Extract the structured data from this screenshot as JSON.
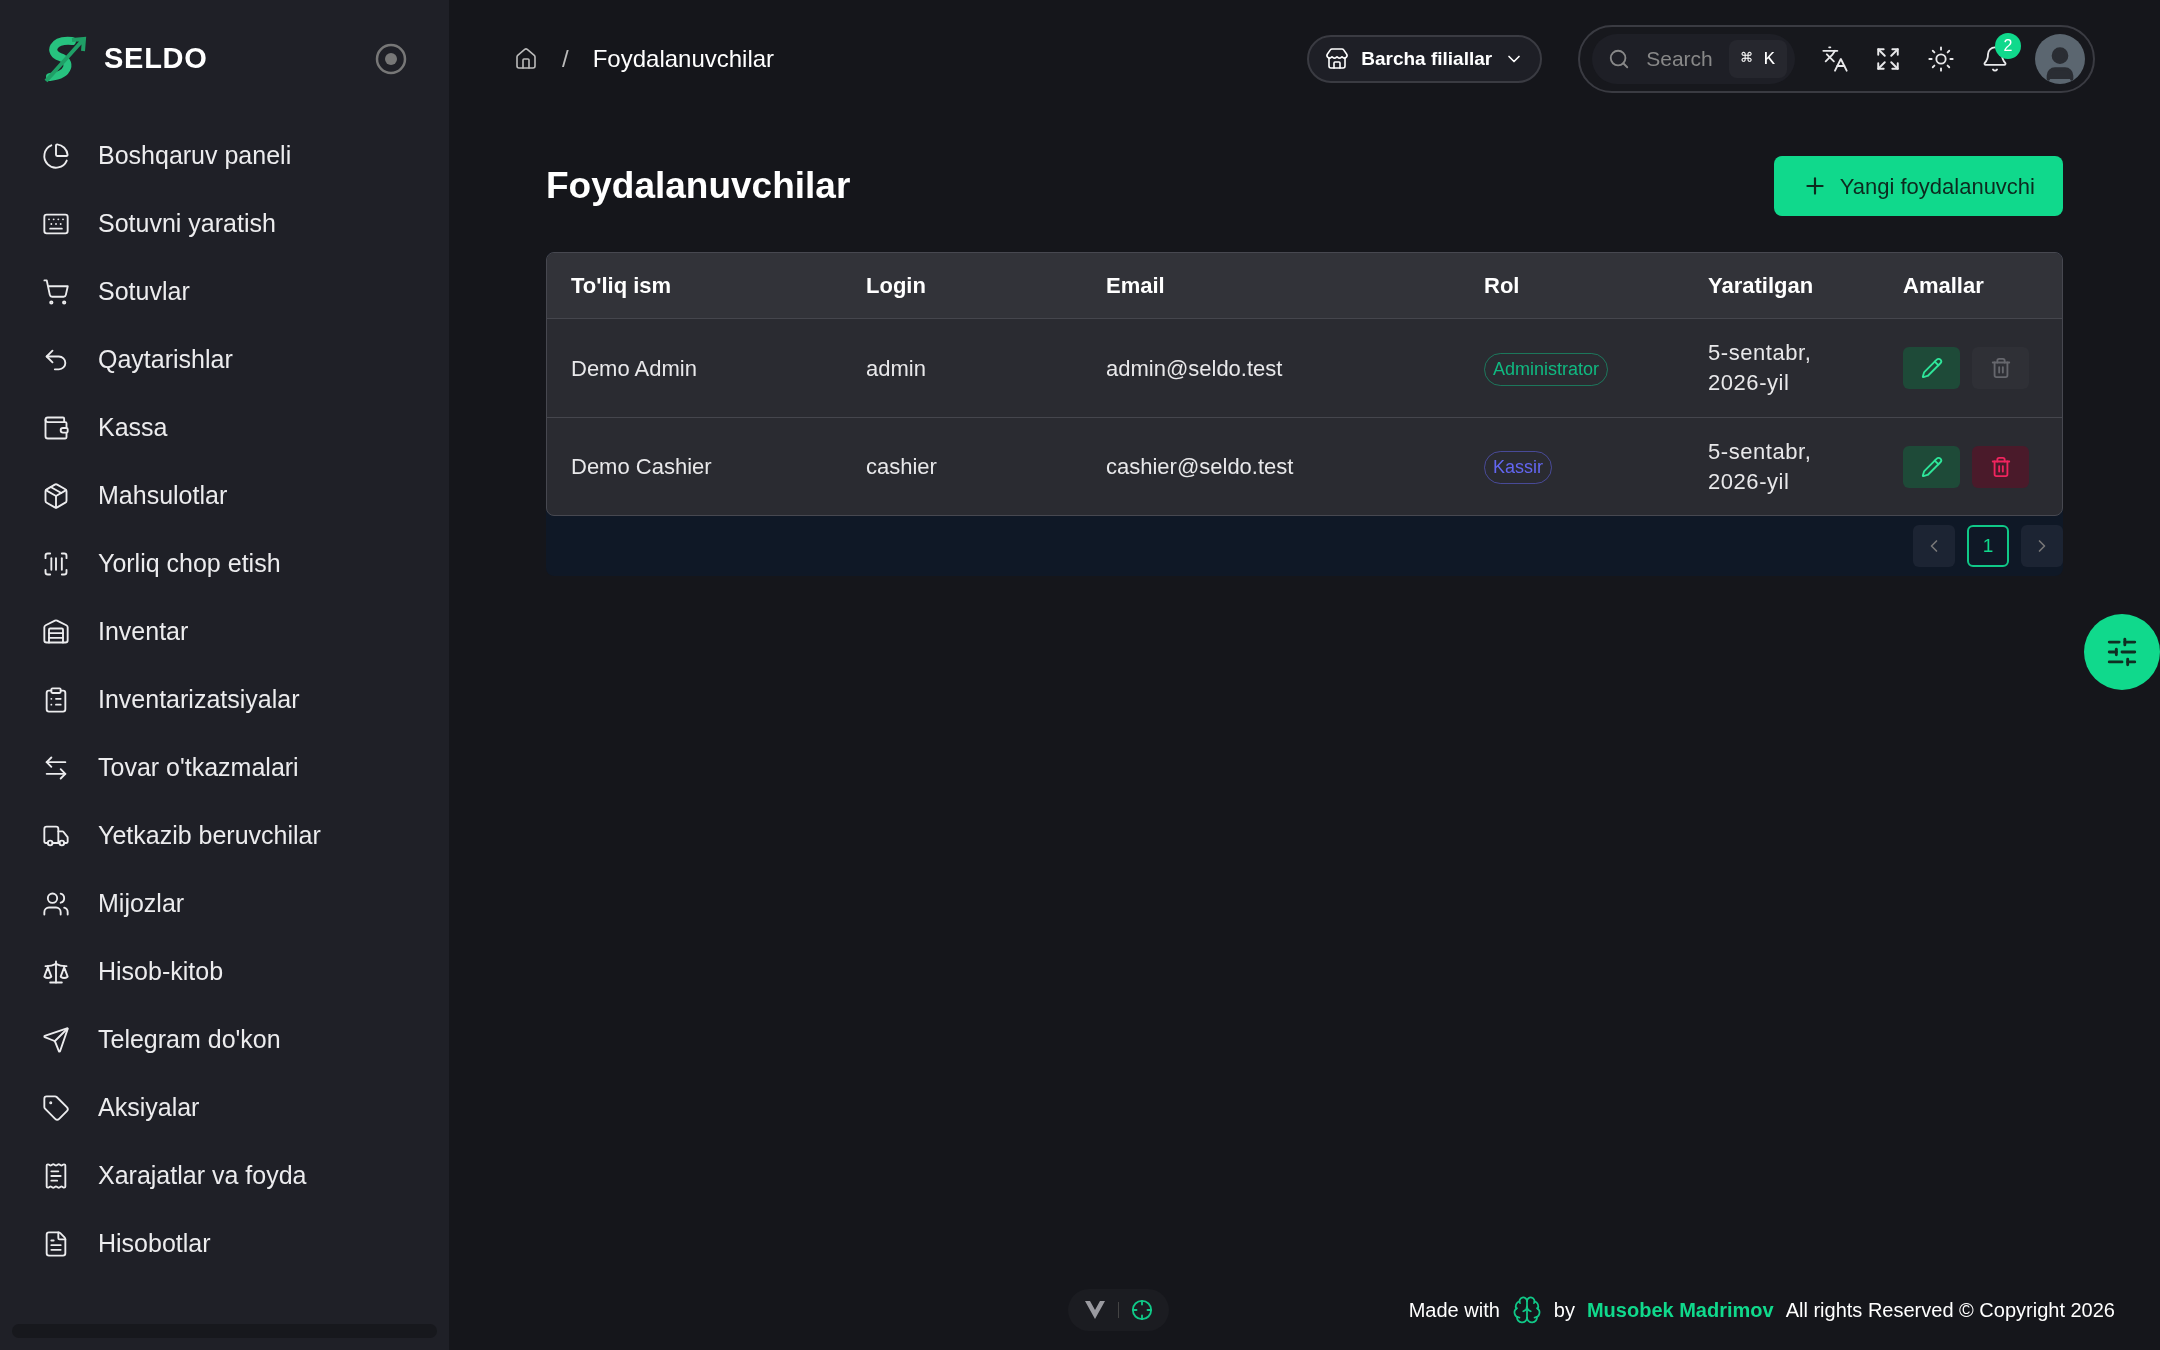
{
  "sidebar": {
    "brand": "SELDO",
    "items": [
      {
        "label": "Boshqaruv paneli"
      },
      {
        "label": "Sotuvni yaratish"
      },
      {
        "label": "Sotuvlar"
      },
      {
        "label": "Qaytarishlar"
      },
      {
        "label": "Kassa"
      },
      {
        "label": "Mahsulotlar"
      },
      {
        "label": "Yorliq chop etish"
      },
      {
        "label": "Inventar"
      },
      {
        "label": "Inventarizatsiyalar"
      },
      {
        "label": "Tovar o'tkazmalari"
      },
      {
        "label": "Yetkazib beruvchilar"
      },
      {
        "label": "Mijozlar"
      },
      {
        "label": "Hisob-kitob"
      },
      {
        "label": "Telegram do'kon"
      },
      {
        "label": "Aksiyalar"
      },
      {
        "label": "Xarajatlar va foyda"
      },
      {
        "label": "Hisobotlar"
      }
    ]
  },
  "breadcrumb": {
    "separator": "/",
    "current": "Foydalanuvchilar"
  },
  "topbar": {
    "branch": "Barcha filiallar",
    "search": {
      "placeholder": "Search",
      "shortcut": [
        "⌘",
        "K"
      ]
    },
    "notifications": "2"
  },
  "page": {
    "title": "Foydalanuvchilar",
    "add_button": "Yangi foydalanuvchi"
  },
  "table": {
    "columns": [
      "To'liq ism",
      "Login",
      "Email",
      "Rol",
      "Yaratilgan",
      "Amallar"
    ],
    "rows": [
      {
        "name": "Demo Admin",
        "login": "admin",
        "email": "admin@seldo.test",
        "role": "Administrator",
        "color": "#10b981",
        "created": [
          "5-sentabr,",
          "2026-yil"
        ],
        "delete_disabled": true
      },
      {
        "name": "Demo Cashier",
        "login": "cashier",
        "email": "cashier@seldo.test",
        "role": "Kassir",
        "color": "#6366f1",
        "created": [
          "5-sentabr,",
          "2026-yil"
        ],
        "delete_disabled": false
      }
    ]
  },
  "pagination": {
    "pages": [
      {
        "label": "1",
        "selected": true
      }
    ]
  },
  "footer": {
    "made_with": "Made with",
    "by": "by",
    "author": "Musobek Madrimov",
    "rights": "All rights Reserved © Copyright 2026"
  }
}
